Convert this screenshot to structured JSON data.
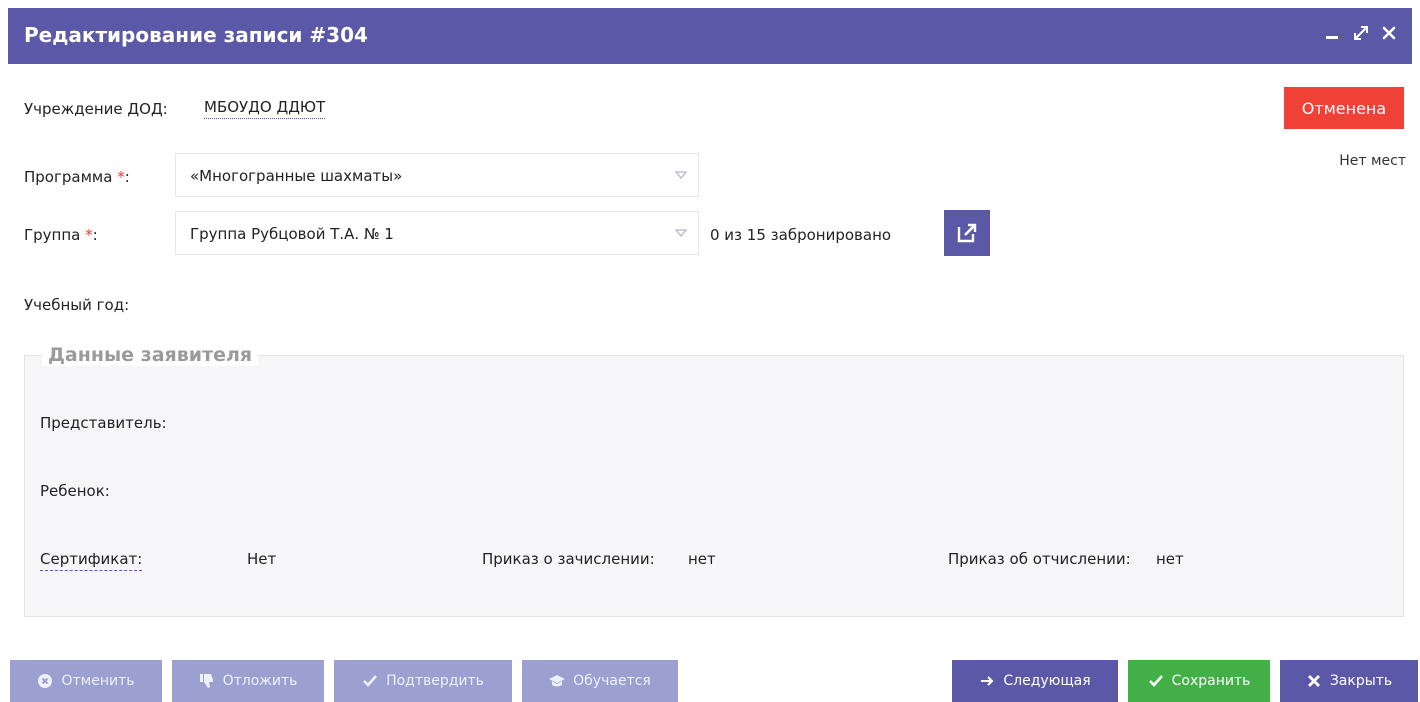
{
  "window": {
    "title": "Редактирование записи #304"
  },
  "form": {
    "institution_label": "Учреждение ДОД:",
    "institution_value": "МБОУДО ДДЮТ",
    "program_label": "Программа",
    "program_value": "«Многогранные шахматы»",
    "group_label": "Группа",
    "group_value": "Группа Рубцовой Т.А. № 1",
    "required_mark": "*",
    "colon": ":",
    "booked_text": "0 из 15 забронировано",
    "school_year_label": "Учебный год:",
    "status_label": "Отменена",
    "no_seats_text": "Нет мест"
  },
  "applicant": {
    "legend": "Данные заявителя",
    "representative_label": "Представитель:",
    "child_label": "Ребенок:",
    "certificate_label": "Сертификат:",
    "certificate_value": "Нет",
    "enroll_order_label": "Приказ о зачислении:",
    "enroll_order_value": "нет",
    "expel_order_label": "Приказ об отчислении:",
    "expel_order_value": "нет"
  },
  "footer": {
    "cancel": "Отменить",
    "postpone": "Отложить",
    "confirm": "Подтвердить",
    "studying": "Обучается",
    "next": "Следующая",
    "save": "Сохранить",
    "close": "Закрыть"
  },
  "colors": {
    "accent": "#5c58a8",
    "danger": "#ef4136",
    "success": "#43b047",
    "disabled": "#9ba0d0"
  },
  "icons": {
    "minimize": "minimize-icon",
    "maximize": "maximize-icon",
    "close": "close-icon",
    "edit": "edit-external-icon",
    "cancel": "x-circle-icon",
    "postpone": "thumbs-down-icon",
    "confirm": "check-icon",
    "studying": "graduation-cap-icon",
    "next": "arrow-right-icon",
    "save": "check-icon",
    "close_btn": "close-icon"
  }
}
